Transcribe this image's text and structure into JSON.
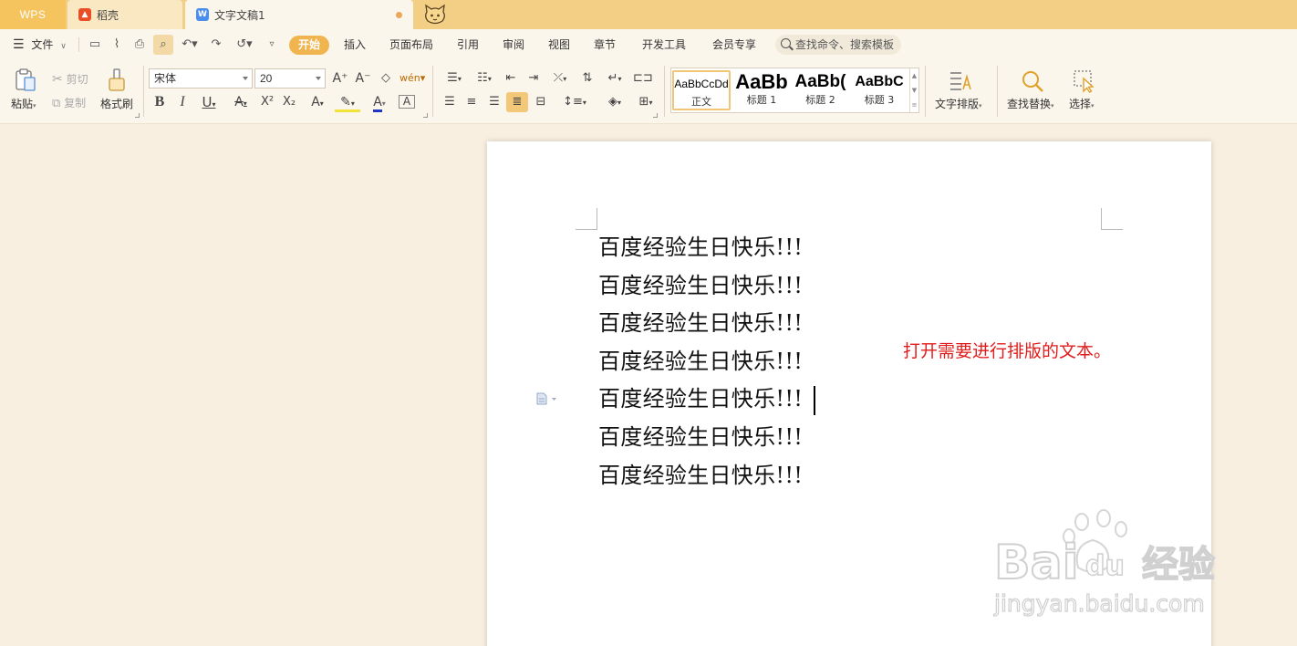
{
  "tabs": {
    "wps": "WPS",
    "daoke": "稻壳",
    "document": "文字文稿1"
  },
  "menu": {
    "file": "文件",
    "items": [
      "开始",
      "插入",
      "页面布局",
      "引用",
      "审阅",
      "视图",
      "章节",
      "开发工具",
      "会员专享"
    ],
    "search_placeholder": "查找命令、搜索模板"
  },
  "ribbon": {
    "paste": "粘贴",
    "cut": "剪切",
    "copy": "复制",
    "format_painter": "格式刷",
    "font_name": "宋体",
    "font_size": "20",
    "styles": [
      {
        "preview": "AaBbCcDd",
        "name": "正文"
      },
      {
        "preview": "AaBb",
        "name": "标题 1"
      },
      {
        "preview": "AaBb(",
        "name": "标题 2"
      },
      {
        "preview": "AaBbC",
        "name": "标题 3"
      }
    ],
    "text_layout": "文字排版",
    "find_replace": "查找替换",
    "select": "选择"
  },
  "document": {
    "lines": [
      "百度经验生日快乐!!!",
      "百度经验生日快乐!!!",
      "百度经验生日快乐!!!",
      "百度经验生日快乐!!!",
      "百度经验生日快乐!!!",
      "百度经验生日快乐!!!",
      "百度经验生日快乐!!!"
    ],
    "cursor_line": 4
  },
  "annotation": "打开需要进行排版的文本。",
  "watermark": {
    "brand": "Bai",
    "brand_suffix": "du",
    "jingyan": "经验",
    "url": "jingyan.baidu.com"
  },
  "colors": {
    "accent": "#f0b54f",
    "annotation": "#e11b1b",
    "titlebar": "#f3cf85",
    "workspace": "#f8efe0"
  }
}
